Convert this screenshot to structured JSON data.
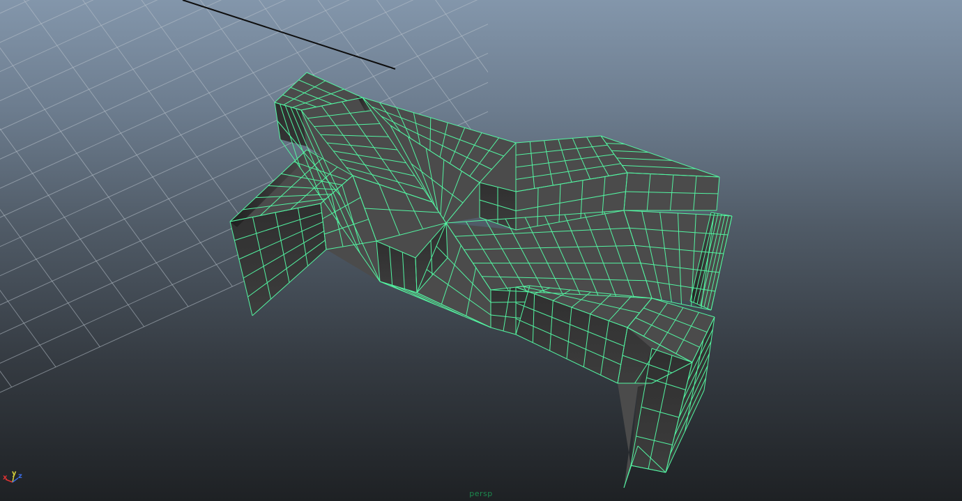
{
  "viewport": {
    "camera_label": "persp",
    "wire_color": "#53f5a2",
    "face_color": "#474747",
    "grid_color": "#b9c3cc"
  },
  "axis_gizmo": {
    "x_label": "x",
    "y_label": "y",
    "z_label": "z",
    "x_color": "#e03232",
    "y_color": "#d8d23a",
    "z_color": "#3a6be0"
  }
}
